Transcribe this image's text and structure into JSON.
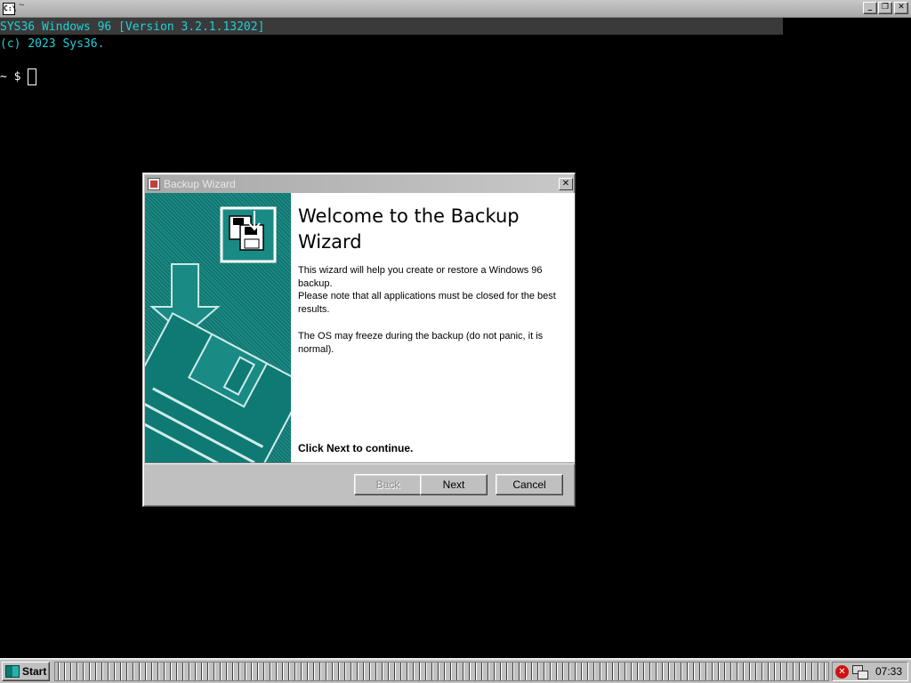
{
  "terminal": {
    "titlebar_text": "~",
    "icon_text": "C:\\",
    "window_buttons": {
      "minimize": "_",
      "restore": "❐",
      "close": "✕"
    },
    "lines": [
      "SYS36 Windows 96 [Version 3.2.1.13202]",
      "(c) 2023 Sys36."
    ],
    "prompt": "~ $ ",
    "colors": {
      "text": "#1fd0d8",
      "background": "#000000"
    }
  },
  "wizard": {
    "title": "Backup Wizard",
    "close_label": "✕",
    "heading": "Welcome to the Backup Wizard",
    "paragraphs": [
      "This wizard will help you create or restore a Windows 96 backup.",
      "Please note that all applications must be closed for the best results.",
      "The OS may freeze during the backup (do not panic, it is normal)."
    ],
    "continue_text": "Click Next to continue.",
    "buttons": {
      "back": "Back",
      "next": "Next",
      "cancel": "Cancel"
    },
    "back_enabled": false,
    "side_color": "#1a8a84"
  },
  "taskbar": {
    "start_label": "Start",
    "clock": "07:33",
    "tray_icons": [
      "error-icon",
      "network-icon"
    ]
  }
}
